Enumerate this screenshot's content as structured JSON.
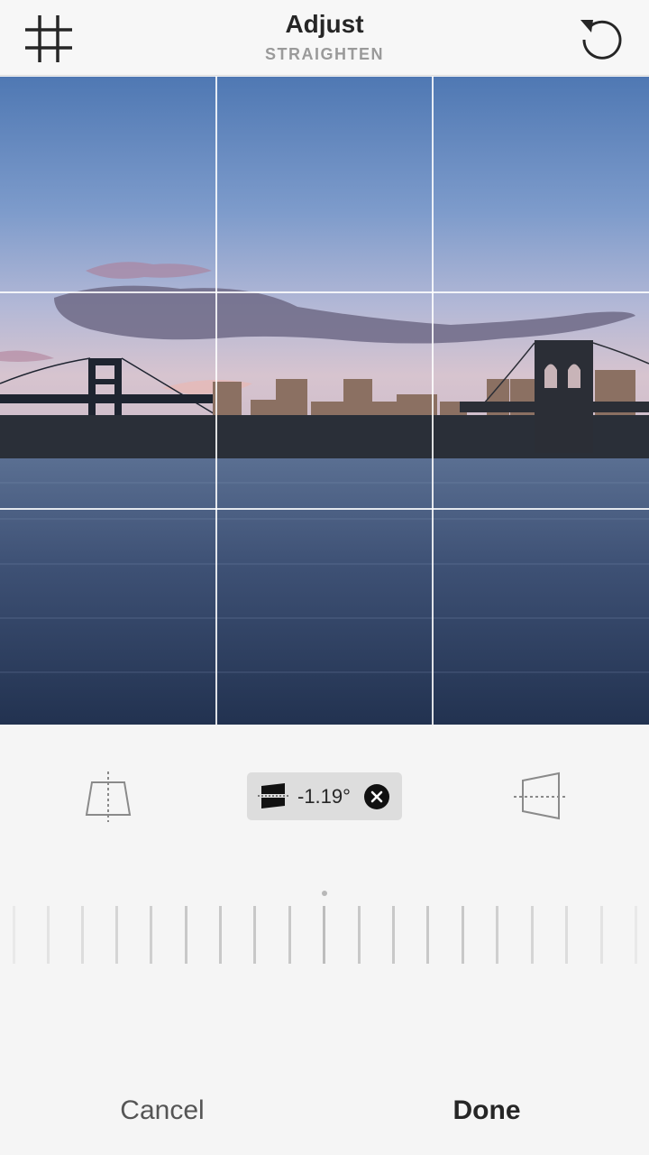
{
  "header": {
    "title": "Adjust",
    "subtitle": "STRAIGHTEN",
    "left_icon": "grid-icon",
    "right_icon": "rotate-icon"
  },
  "photo": {
    "description_icon": "photo-canvas",
    "grid": "3x3"
  },
  "controls": {
    "vertical_perspective_icon": "vertical-perspective-icon",
    "horizontal_perspective_icon": "horizontal-perspective-icon",
    "straighten": {
      "icon": "tilt-icon",
      "value": "-1.19°",
      "reset_icon": "close-icon"
    },
    "dial_ticks": 19
  },
  "footer": {
    "cancel_label": "Cancel",
    "done_label": "Done"
  },
  "colors": {
    "background": "#f5f5f5",
    "text": "#262626",
    "muted": "#9a9a9a",
    "pill": "#dddddd"
  }
}
